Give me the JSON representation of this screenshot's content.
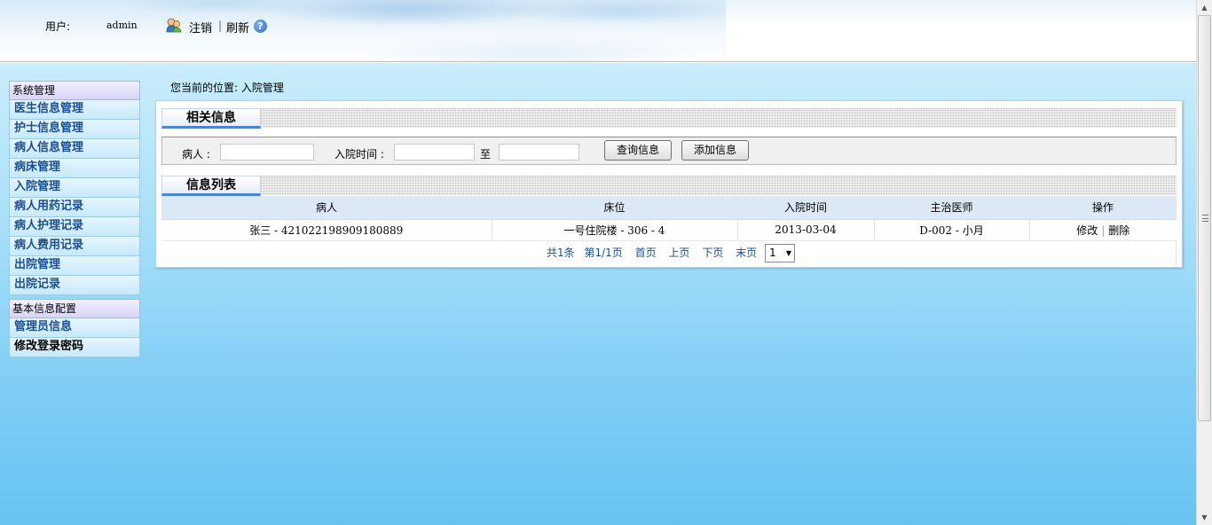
{
  "header": {
    "user_label": "用户:",
    "user_name": "admin",
    "logout": "注销",
    "separator": "|",
    "refresh": "刷新",
    "help_icon": "?"
  },
  "sidebar": {
    "group1_title": "系统管理",
    "group1_items": [
      "医生信息管理",
      "护士信息管理",
      "病人信息管理",
      "病床管理",
      "入院管理",
      "病人用药记录",
      "病人护理记录",
      "病人费用记录",
      "出院管理",
      "出院记录"
    ],
    "group2_title": "基本信息配置",
    "group2_items": [
      "管理员信息",
      "修改登录密码"
    ]
  },
  "breadcrumb": "您当前的位置: 入院管理",
  "search_section": {
    "title": "相关信息",
    "patient_label": "病人 :",
    "patient_value": "",
    "time_label": "入院时间 :",
    "time_from": "",
    "to_label": "至",
    "time_to": "",
    "query_button": "查询信息",
    "add_button": "添加信息"
  },
  "list_section": {
    "title": "信息列表",
    "columns": [
      "病人",
      "床位",
      "入院时间",
      "主治医师",
      "操作"
    ],
    "rows": [
      {
        "patient": "张三 - 421022198909180889",
        "bed": "一号住院楼 - 306 - 4",
        "admit_time": "2013-03-04",
        "doctor": "D-002 - 小月",
        "edit": "修改",
        "delete": "删除"
      }
    ]
  },
  "pager": {
    "total": "共1条",
    "page_info": "第1/1页",
    "first": "首页",
    "prev": "上页",
    "next": "下页",
    "last": "末页",
    "page_select": "1"
  },
  "colors": {
    "menu_text": "#1a4f8f",
    "tab_underline": "#4a85d0",
    "body_bg_top": "#c9edfb",
    "body_bg_bottom": "#67c3f3"
  }
}
